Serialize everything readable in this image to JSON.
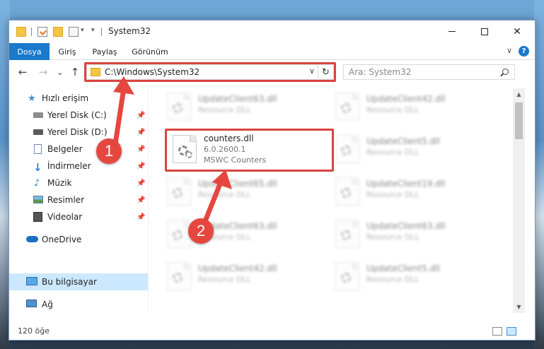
{
  "window": {
    "title": "System32",
    "controls": {
      "minimize": "—",
      "maximize": "☐",
      "close": "✕"
    }
  },
  "ribbon": {
    "tabs": [
      "Dosya",
      "Giriş",
      "Paylaş",
      "Görünüm"
    ],
    "help": "?"
  },
  "navigation": {
    "back": "←",
    "forward": "→",
    "recent": "⌄",
    "up": "↑",
    "address": "C:\\Windows\\System32",
    "search_placeholder": "Ara: System32"
  },
  "sidebar": {
    "items": [
      {
        "label": "Hızlı erişim",
        "icon": "star-icon",
        "pinned": false
      },
      {
        "label": "Yerel Disk (C:)",
        "icon": "drive-icon",
        "pinned": true
      },
      {
        "label": "Yerel Disk (D:)",
        "icon": "drive-icon",
        "pinned": true
      },
      {
        "label": "Belgeler",
        "icon": "document-icon",
        "pinned": true
      },
      {
        "label": "İndirmeler",
        "icon": "download-icon",
        "pinned": true
      },
      {
        "label": "Müzik",
        "icon": "music-icon",
        "pinned": true
      },
      {
        "label": "Resimler",
        "icon": "pictures-icon",
        "pinned": true
      },
      {
        "label": "Videolar",
        "icon": "video-icon",
        "pinned": true
      },
      {
        "label": "OneDrive",
        "icon": "cloud-icon",
        "pinned": false
      },
      {
        "label": "Bu bilgisayar",
        "icon": "computer-icon",
        "pinned": false,
        "selected": true
      },
      {
        "label": "Ağ",
        "icon": "network-icon",
        "pinned": false
      }
    ]
  },
  "files": {
    "highlighted": {
      "name": "counters.dll",
      "version": "6.0.2600.1",
      "description": "MSWC Counters"
    },
    "background": [
      {
        "name": "UpdateClient63.dll",
        "description": "Resource DLL"
      },
      {
        "name": "UpdateClient42.dll",
        "description": "Resource DLL"
      },
      {
        "name": "UpdateClient5.dll",
        "description": "Resource DLL"
      },
      {
        "name": "UpdateClient65.dll",
        "description": "Resource DLL"
      },
      {
        "name": "UpdateClient19.dll",
        "description": "Resource DLL"
      },
      {
        "name": "UpdateClient63.dll",
        "description": "Resource DLL"
      },
      {
        "name": "UpdateClient63.dll",
        "description": "Resource DLL"
      },
      {
        "name": "UpdateClient42.dll",
        "description": "Resource DLL"
      },
      {
        "name": "UpdateClient5.dll",
        "description": "Resource DLL"
      }
    ]
  },
  "status": {
    "item_count": "120 öğe"
  },
  "annotations": {
    "step1": "1",
    "step2": "2",
    "accent_color": "#e5473f"
  }
}
